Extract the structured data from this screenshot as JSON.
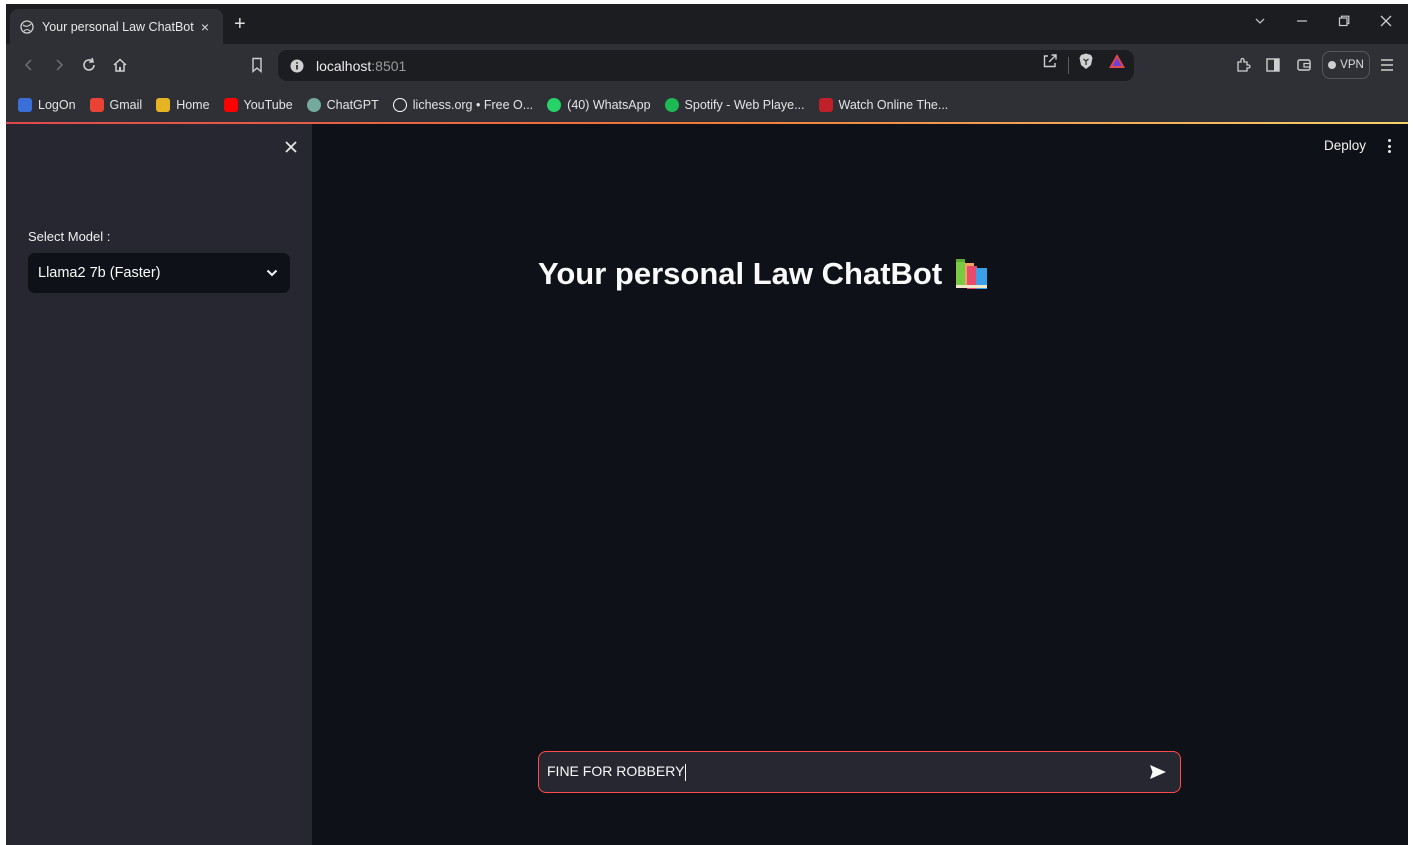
{
  "browser": {
    "tab": {
      "title": "Your personal Law ChatBot",
      "close": "×"
    },
    "new_tab": "+",
    "address": {
      "host": "localhost",
      "port": ":8501"
    },
    "vpn_label": "VPN",
    "bookmarks": [
      {
        "label": "LogOn",
        "icon": "logon-icon",
        "color": "#3b6fd8"
      },
      {
        "label": "Gmail",
        "icon": "gmail-icon",
        "color": "#ea4335"
      },
      {
        "label": "Home",
        "icon": "home-icon",
        "color": "#e6b422"
      },
      {
        "label": "YouTube",
        "icon": "youtube-icon",
        "color": "#ff0000"
      },
      {
        "label": "ChatGPT",
        "icon": "chatgpt-icon",
        "color": "#74aa9c"
      },
      {
        "label": "lichess.org • Free O...",
        "icon": "lichess-icon",
        "color": "#ffffff"
      },
      {
        "label": "(40) WhatsApp",
        "icon": "whatsapp-icon",
        "color": "#25d366"
      },
      {
        "label": "Spotify - Web Playe...",
        "icon": "spotify-icon",
        "color": "#1db954"
      },
      {
        "label": "Watch Online The...",
        "icon": "watch-icon",
        "color": "#c0202a"
      }
    ]
  },
  "sidebar": {
    "close": "×",
    "select_label": "Select Model :",
    "selected_model": "Llama2 7b (Faster)"
  },
  "header": {
    "deploy_label": "Deploy"
  },
  "main": {
    "title": "Your personal Law ChatBot",
    "input_value": "FINE FOR ROBBERY"
  },
  "colors": {
    "app_bg": "#0e1117",
    "sidebar_bg": "#262730",
    "accent": "#ff4b4b"
  }
}
